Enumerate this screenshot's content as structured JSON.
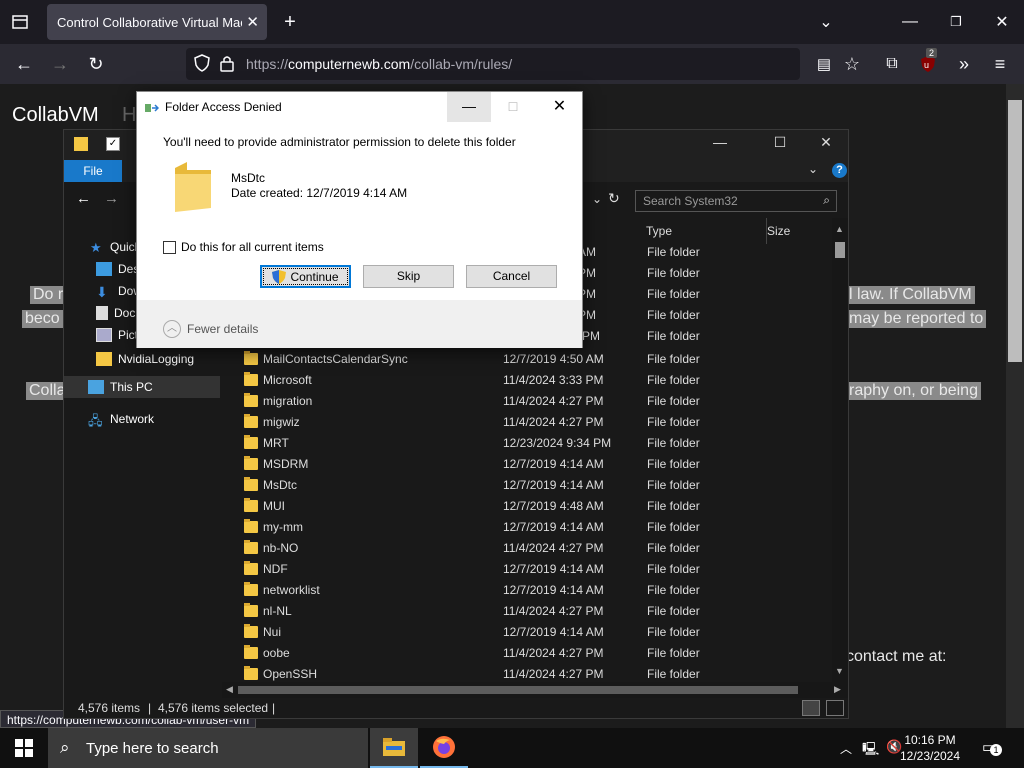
{
  "browser": {
    "tab_title": "Control Collaborative Virtual Machi",
    "url_scheme": "https://",
    "url_host": "computernewb.com",
    "url_path": "/collab-vm/rules/",
    "extension_badge": "2"
  },
  "page": {
    "brand": "CollabVM",
    "brand_next": "H",
    "text_left1": "Do r",
    "text_left2": "beco",
    "text_left3": "Colla",
    "text_right1": "l law. If CollabVM",
    "text_right2": "may be reported to",
    "text_right3": "raphy on, or being",
    "contact": "contact me at:",
    "status_url": "https://computernewb.com/collab-vm/user-vm"
  },
  "explorer": {
    "file_tab": "File",
    "help": "?",
    "search_placeholder": "Search System32",
    "columns": {
      "type": "Type",
      "size": "Size"
    },
    "nav": [
      {
        "label": "Quick access"
      },
      {
        "label": "Desktop"
      },
      {
        "label": "Downloads"
      },
      {
        "label": "Documents"
      },
      {
        "label": "Pictures"
      },
      {
        "label": "NvidiaLogging"
      },
      {
        "label": "This PC"
      },
      {
        "label": "Network"
      }
    ],
    "partial_rows": [
      {
        "date": "AM",
        "type": "File folder"
      },
      {
        "date": "PM",
        "type": "File folder"
      },
      {
        "date": "PM",
        "type": "File folder"
      },
      {
        "date": "PM",
        "type": "File folder"
      },
      {
        "date": "7 PM",
        "type": "File folder"
      }
    ],
    "rows": [
      {
        "name": "MailContactsCalendarSync",
        "date": "12/7/2019 4:50 AM",
        "type": "File folder"
      },
      {
        "name": "Microsoft",
        "date": "11/4/2024 3:33 PM",
        "type": "File folder"
      },
      {
        "name": "migration",
        "date": "11/4/2024 4:27 PM",
        "type": "File folder"
      },
      {
        "name": "migwiz",
        "date": "11/4/2024 4:27 PM",
        "type": "File folder"
      },
      {
        "name": "MRT",
        "date": "12/23/2024 9:34 PM",
        "type": "File folder"
      },
      {
        "name": "MSDRM",
        "date": "12/7/2019 4:14 AM",
        "type": "File folder"
      },
      {
        "name": "MsDtc",
        "date": "12/7/2019 4:14 AM",
        "type": "File folder"
      },
      {
        "name": "MUI",
        "date": "12/7/2019 4:48 AM",
        "type": "File folder"
      },
      {
        "name": "my-mm",
        "date": "12/7/2019 4:14 AM",
        "type": "File folder"
      },
      {
        "name": "nb-NO",
        "date": "11/4/2024 4:27 PM",
        "type": "File folder"
      },
      {
        "name": "NDF",
        "date": "12/7/2019 4:14 AM",
        "type": "File folder"
      },
      {
        "name": "networklist",
        "date": "12/7/2019 4:14 AM",
        "type": "File folder"
      },
      {
        "name": "nl-NL",
        "date": "11/4/2024 4:27 PM",
        "type": "File folder"
      },
      {
        "name": "Nui",
        "date": "12/7/2019 4:14 AM",
        "type": "File folder"
      },
      {
        "name": "oobe",
        "date": "11/4/2024 4:27 PM",
        "type": "File folder"
      },
      {
        "name": "OpenSSH",
        "date": "11/4/2024 4:27 PM",
        "type": "File folder"
      }
    ],
    "status_items": "4,576 items",
    "status_selected": "4,576 items selected"
  },
  "dialog": {
    "title": "Folder Access Denied",
    "message": "You'll need to provide administrator permission to delete this folder",
    "folder_name": "MsDtc",
    "folder_date": "Date created: 12/7/2019 4:14 AM",
    "checkbox_label": "Do this for all current items",
    "continue": "Continue",
    "skip": "Skip",
    "cancel": "Cancel",
    "fewer_details": "Fewer details"
  },
  "taskbar": {
    "search_placeholder": "Type here to search",
    "time": "10:16 PM",
    "date": "12/23/2024",
    "notification_count": "1"
  }
}
